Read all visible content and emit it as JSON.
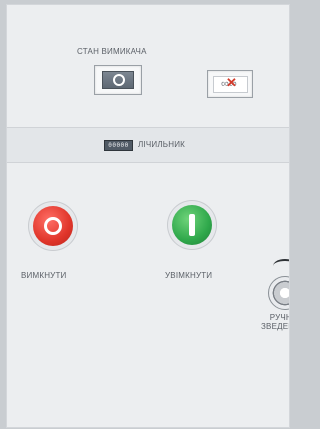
{
  "status": {
    "title": "СТАН ВИМИКАЧА",
    "indicator_on_icon": "breaker-on-icon",
    "indicator_off_icon": "breaker-off-icon"
  },
  "counter": {
    "display": "00000",
    "label": "ЛІЧИЛЬНИК"
  },
  "buttons": {
    "off_label": "ВИМКНУТИ",
    "on_label": "УВІМКНУТИ",
    "off_color": "#e0352a",
    "on_color": "#2fa84b"
  },
  "manual": {
    "label_line1": "РУЧНЕ",
    "label_line2": "ЗВЕДЕННЯ"
  }
}
